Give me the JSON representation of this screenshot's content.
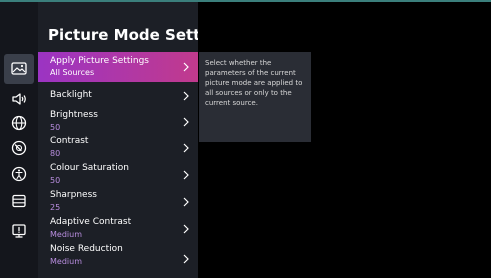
{
  "panel": {
    "title": "Picture Mode Settings"
  },
  "sidebar": {
    "icons": [
      {
        "name": "picture-icon",
        "selected": true
      },
      {
        "name": "sound-icon",
        "selected": false
      },
      {
        "name": "network-globe-icon",
        "selected": false
      },
      {
        "name": "channel-dial-icon",
        "selected": false
      },
      {
        "name": "accessibility-icon",
        "selected": false
      },
      {
        "name": "list-icon",
        "selected": false
      },
      {
        "name": "support-icon",
        "selected": false
      }
    ]
  },
  "menu": {
    "items": [
      {
        "label": "Apply Picture Settings",
        "value": "All Sources",
        "selected": true
      },
      {
        "label": "Backlight",
        "value": ""
      },
      {
        "label": "Brightness",
        "value": "50"
      },
      {
        "label": "Contrast",
        "value": "80"
      },
      {
        "label": "Colour Saturation",
        "value": "50"
      },
      {
        "label": "Sharpness",
        "value": "25"
      },
      {
        "label": "Adaptive Contrast",
        "value": "Medium"
      },
      {
        "label": "Noise Reduction",
        "value": "Medium"
      }
    ]
  },
  "tooltip": {
    "text": "Select whether the parameters of the current picture mode are applied to all sources or only to the current source."
  },
  "colors": {
    "accent_start": "#9b34c3",
    "accent_end": "#c13a8d",
    "value_text": "#b98ee0",
    "panel_bg": "#1c1f26",
    "background": "#000000"
  }
}
